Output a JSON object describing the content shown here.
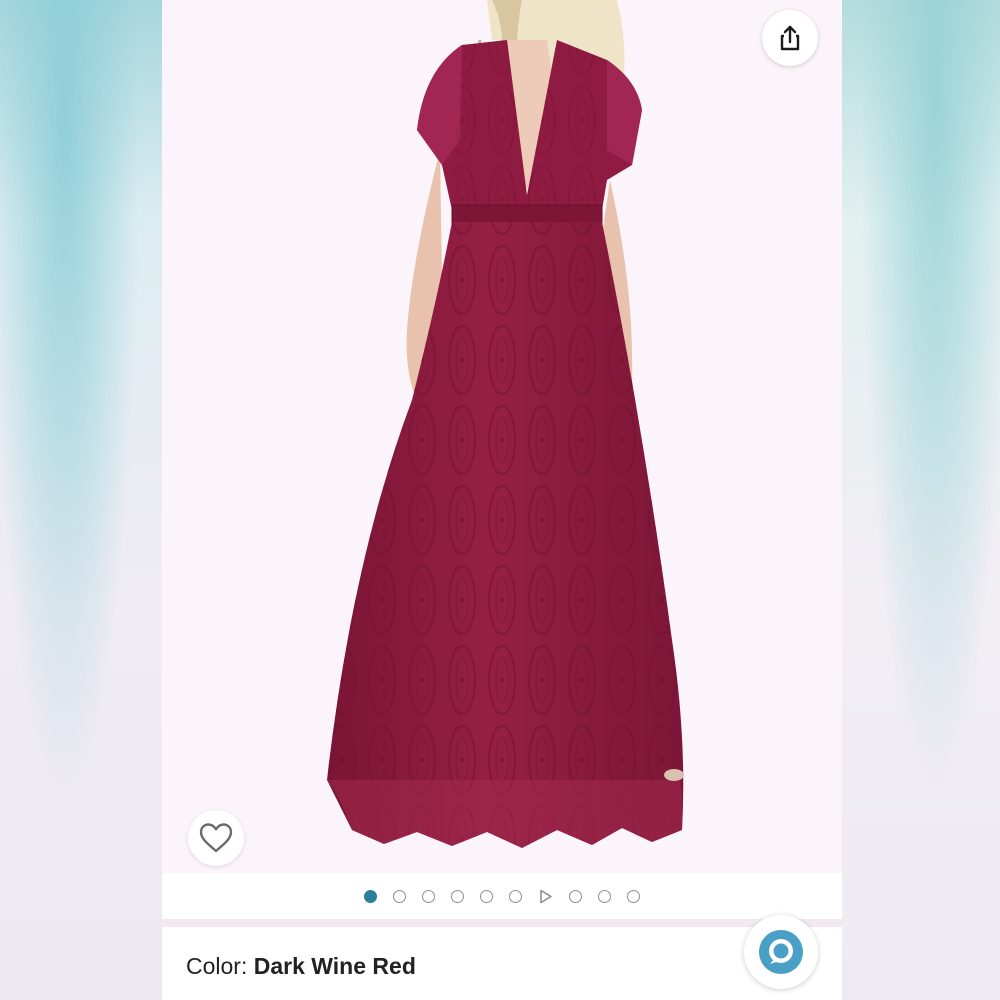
{
  "product": {
    "color_label_prefix": "Color: ",
    "color_value": "Dark Wine Red",
    "dress_color": "#8c1a3c",
    "accent_color": "#2b7f9b"
  },
  "gallery": {
    "total_items": 10,
    "active_index": 0,
    "video_index": 6
  },
  "icons": {
    "share": "share-icon",
    "wishlist": "heart-icon",
    "alexa": "alexa-icon",
    "video": "play-icon"
  }
}
